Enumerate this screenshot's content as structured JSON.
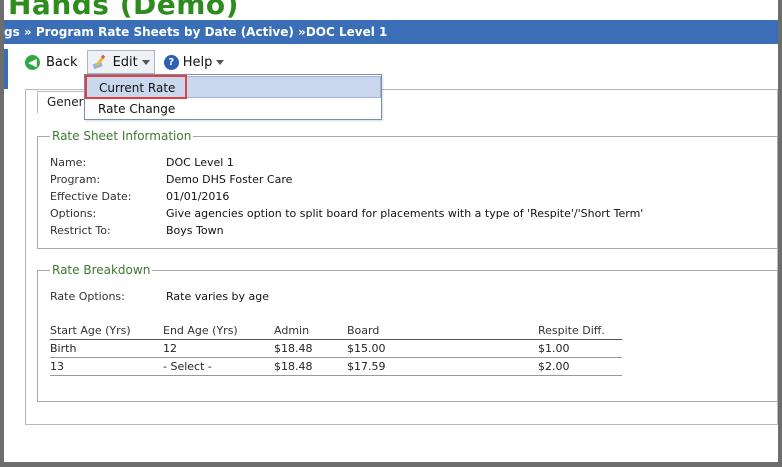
{
  "app": {
    "title": "Hands (Demo)"
  },
  "breadcrumb": {
    "part1": "gs » Program Rate Sheets by Date (Active) » ",
    "part2": "DOC Level 1"
  },
  "toolbar": {
    "back_label": "Back",
    "edit_label": "Edit",
    "help_label": "Help"
  },
  "edit_menu": {
    "items": [
      "Current Rate",
      "Rate Change"
    ],
    "highlighted": "Current Rate"
  },
  "tabs": {
    "general_label": "Genera"
  },
  "rate_sheet_info": {
    "legend": "Rate Sheet Information",
    "fields": [
      {
        "label": "Name:",
        "value": "DOC Level 1"
      },
      {
        "label": "Program:",
        "value": "Demo DHS Foster Care"
      },
      {
        "label": "Effective Date:",
        "value": "01/01/2016"
      },
      {
        "label": "Options:",
        "value": "Give agencies option to split board for placements with a type of 'Respite'/'Short Term'"
      },
      {
        "label": "Restrict To:",
        "value": "Boys Town"
      }
    ]
  },
  "rate_breakdown": {
    "legend": "Rate Breakdown",
    "options_label": "Rate Options:",
    "options_value": "Rate varies by age",
    "columns": [
      "Start Age (Yrs)",
      "End Age (Yrs)",
      "Admin",
      "Board",
      "Respite Diff."
    ],
    "rows": [
      [
        "Birth",
        "12",
        "$18.48",
        "$15.00",
        "$1.00"
      ],
      [
        "13",
        "- Select -",
        "$18.48",
        "$17.59",
        "$2.00"
      ]
    ]
  },
  "colors": {
    "title_green": "#2e8b1e",
    "breadcrumb_blue": "#3a6fb8",
    "legend_green": "#3d7a2e",
    "highlight_red": "#e0413d"
  }
}
